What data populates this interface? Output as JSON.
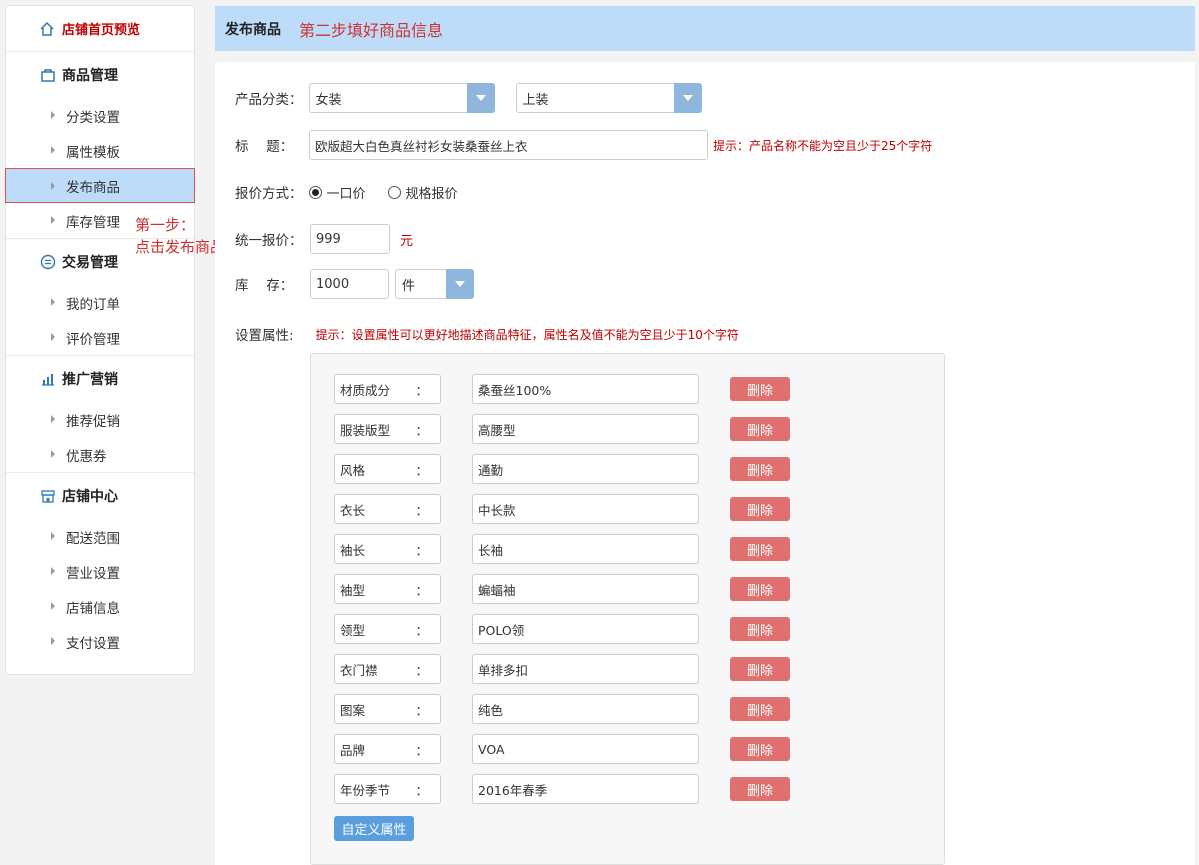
{
  "sidebar": {
    "home": "店铺首页预览",
    "groups": [
      {
        "title": "商品管理",
        "icon": "bag-icon",
        "items": [
          "分类设置",
          "属性模板",
          "发布商品",
          "库存管理"
        ]
      },
      {
        "title": "交易管理",
        "icon": "exchange-icon",
        "items": [
          "我的订单",
          "评价管理"
        ]
      },
      {
        "title": "推广营销",
        "icon": "bar-chart-icon",
        "items": [
          "推荐促销",
          "优惠券"
        ]
      },
      {
        "title": "店铺中心",
        "icon": "store-icon",
        "items": [
          "配送范围",
          "营业设置",
          "店铺信息",
          "支付设置"
        ]
      }
    ]
  },
  "annotation": {
    "line1": "第一步：",
    "line2": "点击发布商品"
  },
  "header": {
    "title": "发布商品",
    "step": "第二步填好商品信息"
  },
  "form": {
    "category_label": "产品分类：",
    "category1": "女装",
    "category2": "上装",
    "title_label": "标　 题：",
    "title_value": "欧版超大白色真丝衬衫女装桑蚕丝上衣",
    "title_hint": "提示：产品名称不能为空且少于25个字符",
    "price_mode_label": "报价方式：",
    "price_mode_options": [
      "一口价",
      "规格报价"
    ],
    "unified_price_label": "统一报价：",
    "unified_price_value": "999",
    "currency": "元",
    "stock_label": "库　 存：",
    "stock_value": "1000",
    "stock_unit": "件",
    "attr_label": "设置属性:",
    "attr_hint": "提示：设置属性可以更好地描述商品特征，属性名及值不能为空且少于10个字符",
    "attributes": [
      {
        "name": "材质成分",
        "value": "桑蚕丝100%"
      },
      {
        "name": "服装版型",
        "value": "高腰型"
      },
      {
        "name": "风格",
        "value": "通勤"
      },
      {
        "name": "衣长",
        "value": "中长款"
      },
      {
        "name": "袖长",
        "value": "长袖"
      },
      {
        "name": "袖型",
        "value": "蝙蝠袖"
      },
      {
        "name": "领型",
        "value": "POLO领"
      },
      {
        "name": "衣门襟",
        "value": "单排多扣"
      },
      {
        "name": "图案",
        "value": "纯色"
      },
      {
        "name": "品牌",
        "value": " VOA"
      },
      {
        "name": "年份季节",
        "value": "2016年春季"
      }
    ],
    "attr_colon": "：",
    "delete_label": "删除",
    "custom_attr_label": "自定义属性"
  }
}
